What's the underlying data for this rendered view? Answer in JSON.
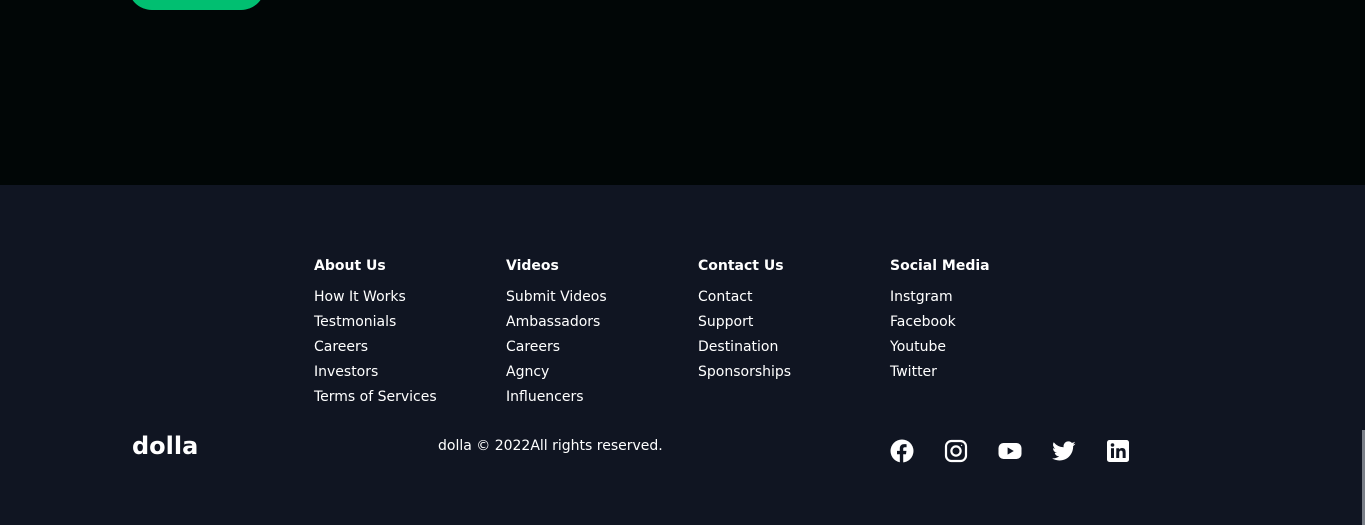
{
  "hero": {
    "cta_label": ""
  },
  "footer": {
    "columns": [
      {
        "title": "About Us",
        "links": [
          "How It Works",
          "Testmonials",
          "Careers",
          "Investors",
          "Terms of Services"
        ]
      },
      {
        "title": "Videos",
        "links": [
          "Submit Videos",
          "Ambassadors",
          "Careers",
          "Agncy",
          "Influencers"
        ]
      },
      {
        "title": "Contact Us",
        "links": [
          "Contact",
          "Support",
          "Destination",
          "Sponsorships"
        ]
      },
      {
        "title": "Social Media",
        "links": [
          "Instgram",
          "Facebook",
          "Youtube",
          "Twitter"
        ]
      }
    ],
    "logo": "dolla",
    "copyright": "dolla © 2022All rights reserved.",
    "social_icons": [
      "facebook-icon",
      "instagram-icon",
      "youtube-icon",
      "twitter-icon",
      "linkedin-icon"
    ]
  },
  "colors": {
    "hero_bg": "#010606",
    "footer_bg": "#101522",
    "accent": "#01bf71",
    "text": "#ffffff"
  }
}
